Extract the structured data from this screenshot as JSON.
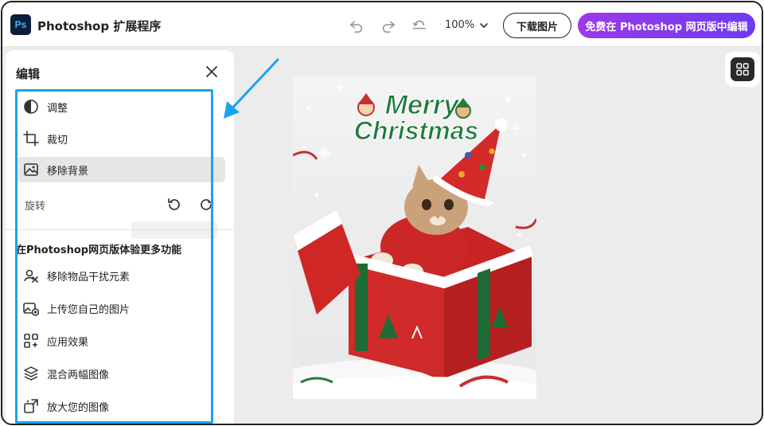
{
  "header": {
    "logo_text": "Ps",
    "title": "Photoshop 扩展程序",
    "zoom": "100%",
    "download_label": "下载图片",
    "edit_label": "免费在 Photoshop 网页版中编辑"
  },
  "panel": {
    "title": "编辑",
    "items": [
      {
        "label": "调整",
        "icon": "adjust-icon"
      },
      {
        "label": "裁切",
        "icon": "crop-icon"
      },
      {
        "label": "移除背景",
        "icon": "remove-background-icon"
      }
    ],
    "rotate_label": "旋转",
    "section_title": "在Photoshop网页版体验更多功能",
    "more_items": [
      {
        "label": "移除物品干扰元素",
        "icon": "remove-object-icon"
      },
      {
        "label": "上传您自己的图片",
        "icon": "upload-image-icon"
      },
      {
        "label": "应用效果",
        "icon": "effects-icon"
      },
      {
        "label": "混合两幅图像",
        "icon": "blend-images-icon"
      },
      {
        "label": "放大您的图像",
        "icon": "upscale-image-icon"
      }
    ]
  },
  "image": {
    "line1": "Merry",
    "line2": "Christmas"
  },
  "colors": {
    "highlight": "#1aa3ef",
    "edit_button_start": "#9b3ae8",
    "edit_button_end": "#6d3bf0",
    "text_green": "#1e7a3c"
  }
}
